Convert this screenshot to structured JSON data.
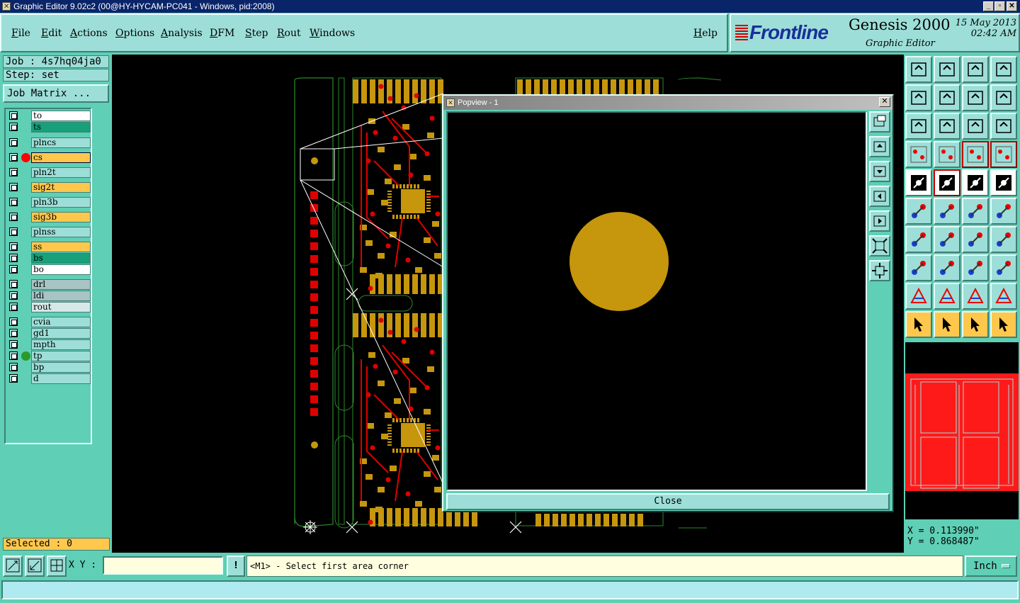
{
  "window": {
    "title": "Graphic Editor 9.02c2 (00@HY-HYCAM-PC041 - Windows, pid:2008)",
    "minimize": "_",
    "maximize": "▫",
    "close": "✕"
  },
  "menu": [
    "File",
    "Edit",
    "Actions",
    "Options",
    "Analysis",
    "DFM",
    "Step",
    "Rout",
    "Windows"
  ],
  "help_label": "Help",
  "logo": {
    "brand": "Frontline",
    "product": "Genesis 2000",
    "subtitle": "Graphic Editor",
    "date": "15 May 2013",
    "time": "02:42 AM"
  },
  "job": {
    "job_label": "Job : 4s7hq04ja0",
    "step_label": "Step: set",
    "matrix_button": "Job Matrix ..."
  },
  "layers": [
    {
      "name": "to",
      "color": "#ffffff",
      "marker": null
    },
    {
      "name": "ts",
      "color": "#17a07a",
      "marker": null
    },
    {
      "name": "plncs",
      "color": "#9ddfd8",
      "marker": null
    },
    {
      "name": "cs",
      "color": "#ffc84d",
      "marker": "#ff0000",
      "work": true
    },
    {
      "name": "pln2t",
      "color": "#9ddfd8",
      "marker": null
    },
    {
      "name": "sig2t",
      "color": "#ffc84d",
      "marker": null
    },
    {
      "name": "pln3b",
      "color": "#9ddfd8",
      "marker": null
    },
    {
      "name": "sig3b",
      "color": "#ffc84d",
      "marker": null
    },
    {
      "name": "plnss",
      "color": "#9ddfd8",
      "marker": null
    },
    {
      "name": "ss",
      "color": "#ffc84d",
      "marker": null
    },
    {
      "name": "bs",
      "color": "#17a07a",
      "marker": null
    },
    {
      "name": "bo",
      "color": "#ffffff",
      "marker": null
    },
    {
      "name": "drl",
      "color": "#a8c4c4",
      "marker": null
    },
    {
      "name": "ldi",
      "color": "#a8c4c4",
      "marker": null
    },
    {
      "name": "rout",
      "color": "#d8e8e8",
      "marker": null
    },
    {
      "name": "cvia",
      "color": "#9ddfd8",
      "marker": null
    },
    {
      "name": "gd1",
      "color": "#9ddfd8",
      "marker": null
    },
    {
      "name": "mpth",
      "color": "#9ddfd8",
      "marker": null
    },
    {
      "name": "tp",
      "color": "#9ddfd8",
      "marker": "#2a9a2a"
    },
    {
      "name": "bp",
      "color": "#9ddfd8",
      "marker": null
    },
    {
      "name": "d",
      "color": "#9ddfd8",
      "marker": null
    }
  ],
  "selected_label": "Selected : 0",
  "popview": {
    "title": "Popview - 1",
    "close_button": "Close"
  },
  "coords": {
    "x": "X = 0.113990\"",
    "y": "Y = 0.868487\""
  },
  "bottom": {
    "xy_label": "X Y :",
    "xy_value": "",
    "bang": "!",
    "status": "<M1> - Select first area corner",
    "units": "Inch"
  },
  "colors": {
    "panel": "#5fcfb5",
    "button": "#9ddfd8",
    "copper": "#c6960c",
    "trace": "#e00000",
    "outline": "#2d8a2d"
  }
}
